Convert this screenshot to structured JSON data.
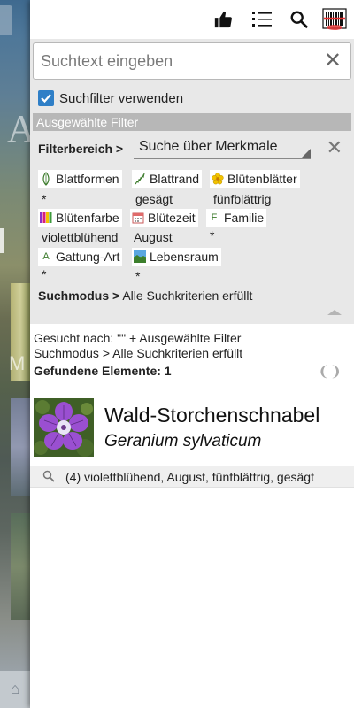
{
  "toolbar": {
    "icons": [
      "thumbs-up-icon",
      "list-icon",
      "search-icon",
      "barcode-icon"
    ]
  },
  "search": {
    "placeholder": "Suchtext eingeben",
    "value": ""
  },
  "filter": {
    "use_filter_label": "Suchfilter verwenden",
    "use_filter_checked": true,
    "selected_header": "Ausgewählte Filter",
    "area_label": "Filterbereich >",
    "area_value": "Suche über Merkmale",
    "chips": [
      {
        "label": "Blattformen",
        "value": "*",
        "icon": "leaf-shape-icon"
      },
      {
        "label": "Blattrand",
        "value": "gesägt",
        "icon": "leaf-edge-icon"
      },
      {
        "label": "Blütenblätter",
        "value": "fünfblättrig",
        "icon": "flower-petals-icon"
      },
      {
        "label": "Blütenfarbe",
        "value": "violettblühend",
        "icon": "color-swatch-icon"
      },
      {
        "label": "Blütezeit",
        "value": "August",
        "icon": "calendar-icon"
      },
      {
        "label": "Familie",
        "value": "*",
        "icon": "family-icon",
        "glyph": "F"
      },
      {
        "label": "Gattung-Art",
        "value": "*",
        "icon": "genus-icon",
        "glyph": "A"
      },
      {
        "label": "Lebensraum",
        "value": "*",
        "icon": "habitat-icon"
      }
    ],
    "mode_label": "Suchmodus >",
    "mode_value": "Alle Suchkriterien erfüllt"
  },
  "results": {
    "searched_for": "Gesucht nach:  \"\" + Ausgewählte Filter",
    "mode_line": "Suchmodus > Alle Suchkriterien erfüllt",
    "found": "Gefundene Elemente: 1",
    "items": [
      {
        "name": "Wald-Storchenschnabel",
        "latin": "Geranium sylvaticum",
        "match": "(4) violettblühend, August, fünfblättrig, gesägt"
      }
    ]
  },
  "colors": {
    "accent": "#2f7fc7",
    "header_gray": "#b7b7b7",
    "panel_bg": "#e8e8e8"
  }
}
